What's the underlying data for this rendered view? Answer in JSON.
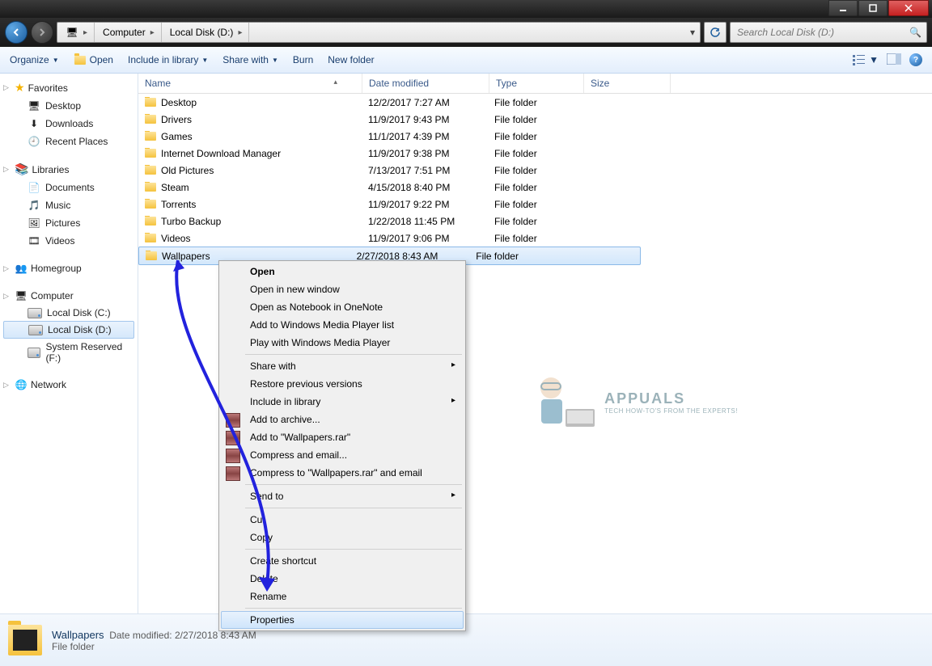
{
  "breadcrumb": {
    "seg1": "Computer",
    "seg2": "Local Disk (D:)"
  },
  "search": {
    "placeholder": "Search Local Disk (D:)"
  },
  "toolbar": {
    "organize": "Organize",
    "open": "Open",
    "include": "Include in library",
    "share": "Share with",
    "burn": "Burn",
    "newfolder": "New folder"
  },
  "nav": {
    "fav": "Favorites",
    "fav_items": [
      "Desktop",
      "Downloads",
      "Recent Places"
    ],
    "lib": "Libraries",
    "lib_items": [
      "Documents",
      "Music",
      "Pictures",
      "Videos"
    ],
    "home": "Homegroup",
    "comp": "Computer",
    "comp_items": [
      "Local Disk (C:)",
      "Local Disk (D:)",
      "System Reserved (F:)"
    ],
    "net": "Network"
  },
  "columns": {
    "name": "Name",
    "date": "Date modified",
    "type": "Type",
    "size": "Size"
  },
  "files": [
    {
      "name": "Desktop",
      "date": "12/2/2017 7:27 AM",
      "type": "File folder"
    },
    {
      "name": "Drivers",
      "date": "11/9/2017 9:43 PM",
      "type": "File folder"
    },
    {
      "name": "Games",
      "date": "11/1/2017 4:39 PM",
      "type": "File folder"
    },
    {
      "name": "Internet Download Manager",
      "date": "11/9/2017 9:38 PM",
      "type": "File folder"
    },
    {
      "name": "Old Pictures",
      "date": "7/13/2017 7:51 PM",
      "type": "File folder"
    },
    {
      "name": "Steam",
      "date": "4/15/2018 8:40 PM",
      "type": "File folder"
    },
    {
      "name": "Torrents",
      "date": "11/9/2017 9:22 PM",
      "type": "File folder"
    },
    {
      "name": "Turbo Backup",
      "date": "1/22/2018 11:45 PM",
      "type": "File folder"
    },
    {
      "name": "Videos",
      "date": "11/9/2017 9:06 PM",
      "type": "File folder"
    },
    {
      "name": "Wallpapers",
      "date": "2/27/2018 8:43 AM",
      "type": "File folder"
    }
  ],
  "ctx": {
    "open": "Open",
    "open_new": "Open in new window",
    "open_onenote": "Open as Notebook in OneNote",
    "wmp_add": "Add to Windows Media Player list",
    "wmp_play": "Play with Windows Media Player",
    "share": "Share with",
    "restore": "Restore previous versions",
    "include": "Include in library",
    "archive": "Add to archive...",
    "archive_rar": "Add to \"Wallpapers.rar\"",
    "compress": "Compress and email...",
    "compress_rar": "Compress to \"Wallpapers.rar\" and email",
    "sendto": "Send to",
    "cut": "Cut",
    "copy": "Copy",
    "shortcut": "Create shortcut",
    "del": "Delete",
    "rename": "Rename",
    "props": "Properties"
  },
  "details": {
    "name": "Wallpapers",
    "mod_lbl": "Date modified:",
    "mod": "2/27/2018 8:43 AM",
    "type": "File folder"
  },
  "watermark": {
    "brand": "APPUALS",
    "tag": "TECH HOW-TO'S FROM THE EXPERTS!"
  }
}
